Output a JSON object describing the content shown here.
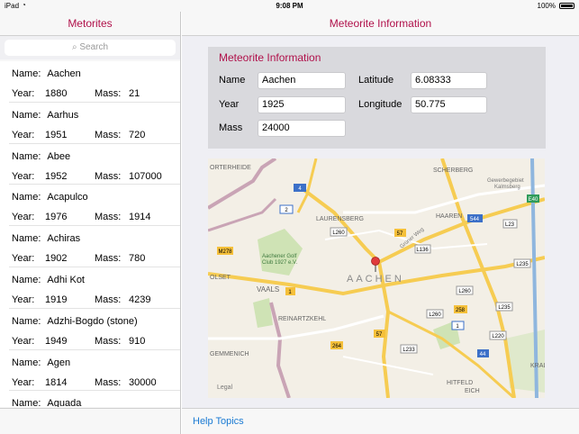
{
  "status": {
    "device": "iPad",
    "time": "9:08 PM",
    "battery": "100%"
  },
  "left_nav": {
    "title": "Metorites"
  },
  "search": {
    "placeholder": "Search"
  },
  "row_labels": {
    "name": "Name:",
    "year": "Year:",
    "mass": "Mass:"
  },
  "meteorites": [
    {
      "name": "Aachen",
      "year": "1880",
      "mass": "21"
    },
    {
      "name": "Aarhus",
      "year": "1951",
      "mass": "720"
    },
    {
      "name": "Abee",
      "year": "1952",
      "mass": "107000"
    },
    {
      "name": "Acapulco",
      "year": "1976",
      "mass": "1914"
    },
    {
      "name": "Achiras",
      "year": "1902",
      "mass": "780"
    },
    {
      "name": "Adhi Kot",
      "year": "1919",
      "mass": "4239"
    },
    {
      "name": "Adzhi-Bogdo (stone)",
      "year": "1949",
      "mass": "910"
    },
    {
      "name": "Agen",
      "year": "1814",
      "mass": "30000"
    },
    {
      "name": "Aguada",
      "year": "",
      "mass": ""
    }
  ],
  "right_nav": {
    "title": "Meteorite Information"
  },
  "info": {
    "title": "Meteorite Information",
    "name_label": "Name",
    "name_value": "Aachen",
    "year_label": "Year",
    "year_value": "1925",
    "mass_label": "Mass",
    "mass_value": "24000",
    "lat_label": "Latitude",
    "lat_value": "6.08333",
    "lon_label": "Longitude",
    "lon_value": "50.775"
  },
  "map": {
    "city": "AACHEN",
    "places": [
      "SCHERBERG",
      "LAURENSBERG",
      "HAAREN",
      "VAALS",
      "REINARTZKEHL",
      "GEMMENICH",
      "HITFELD",
      "EICH",
      "KRAL",
      "OLSET",
      "ORTERHEIDE",
      "Gewerbegebiet Kalmsberg",
      "Aachener Golf Club 1927 e.V.",
      "Grüner Weg",
      "Legal"
    ],
    "shields": [
      "4",
      "2",
      "57",
      "544",
      "L23",
      "L260",
      "L136",
      "M278",
      "L235",
      "1",
      "L260",
      "L260",
      "258",
      "L235",
      "264",
      "57",
      "L233",
      "1",
      "L220",
      "44",
      "E40"
    ]
  },
  "bottom": {
    "help": "Help Topics"
  },
  "colors": {
    "accent": "#b0104a",
    "link": "#1a7ad3",
    "panel": "#d9d9dd"
  }
}
